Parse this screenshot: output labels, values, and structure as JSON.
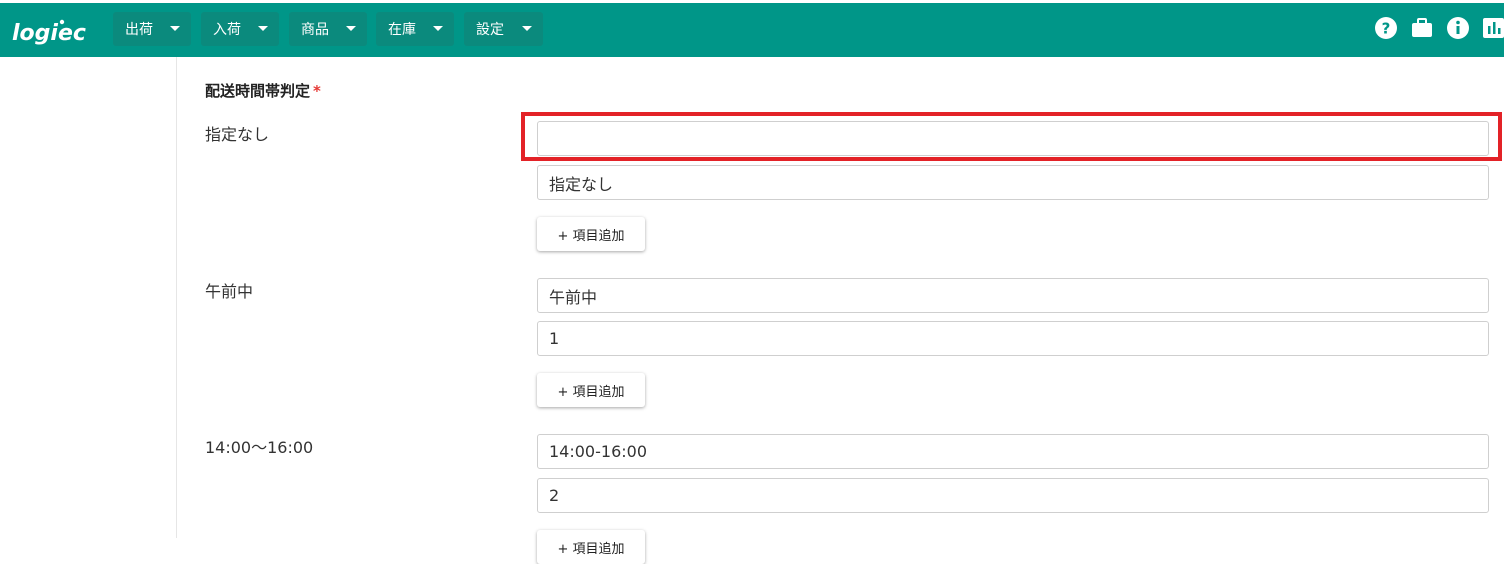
{
  "header": {
    "logo_text": "logiec",
    "nav": [
      {
        "label": "出荷"
      },
      {
        "label": "入荷"
      },
      {
        "label": "商品"
      },
      {
        "label": "在庫"
      },
      {
        "label": "設定"
      }
    ],
    "icons": [
      "help-icon",
      "briefcase-icon",
      "info-icon",
      "chart-icon"
    ],
    "background_color": "#009688"
  },
  "form": {
    "section_title": "配送時間帯判定",
    "required_mark": "*",
    "groups": [
      {
        "label": "指定なし",
        "inputs": [
          {
            "value": "",
            "placeholder": ""
          },
          {
            "value": "指定なし"
          }
        ],
        "add_button_label": "+ 項目追加"
      },
      {
        "label": "午前中",
        "inputs": [
          {
            "value": "午前中"
          },
          {
            "value": "1"
          }
        ],
        "add_button_label": "+ 項目追加"
      },
      {
        "label": "14:00〜16:00",
        "inputs": [
          {
            "value": "14:00-16:00"
          },
          {
            "value": "2"
          }
        ],
        "add_button_label": "+ 項目追加"
      }
    ]
  },
  "highlight_color": "#e32227"
}
